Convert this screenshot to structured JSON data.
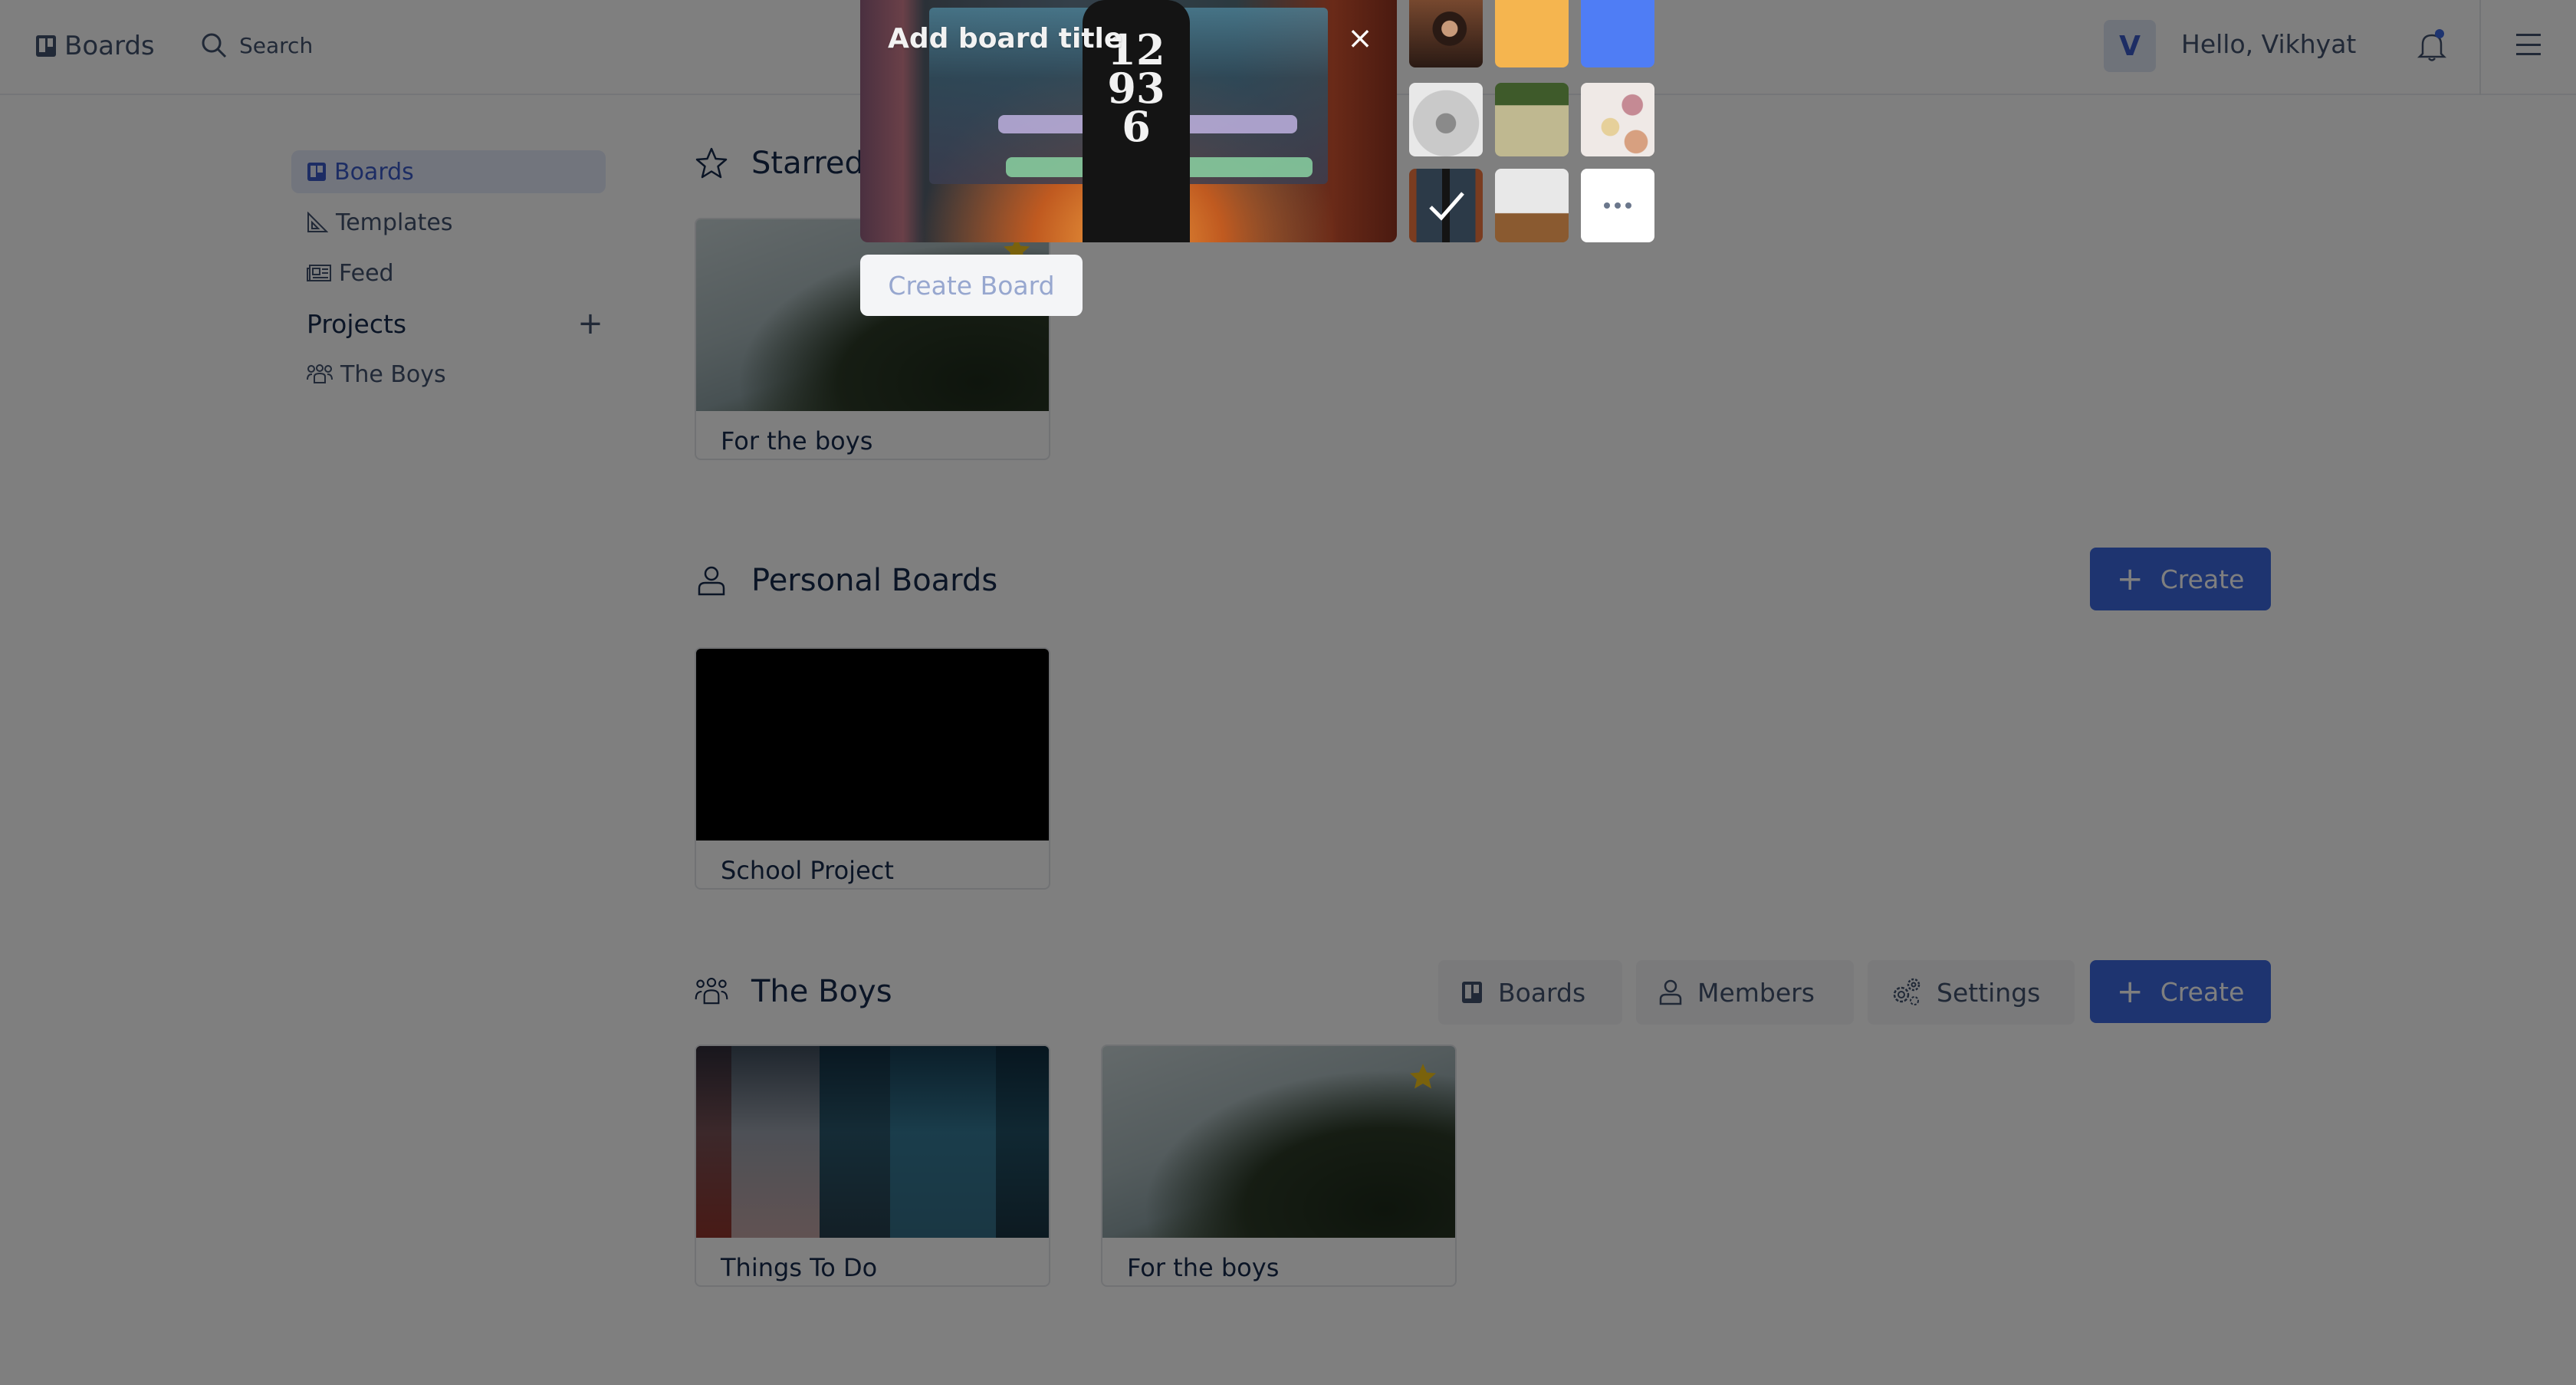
{
  "header": {
    "app_title": "Boards",
    "search_label": "Search",
    "avatar_initial": "V",
    "greeting": "Hello, Vikhyat",
    "notification_dot": true
  },
  "sidebar": {
    "items": [
      {
        "label": "Boards",
        "icon": "board-icon",
        "active": true
      },
      {
        "label": "Templates",
        "icon": "set-square-icon",
        "active": false
      },
      {
        "label": "Feed",
        "icon": "newspaper-icon",
        "active": false
      }
    ],
    "projects_label": "Projects",
    "projects": [
      {
        "label": "The Boys",
        "icon": "users-icon"
      }
    ]
  },
  "sections": {
    "starred": {
      "title": "Starred Boards",
      "visible_title": "Starred",
      "boards": [
        {
          "title": "For the boys",
          "starred": true
        }
      ]
    },
    "personal": {
      "title": "Personal Boards",
      "create_label": "Create",
      "boards": [
        {
          "title": "School Project",
          "starred": false
        }
      ]
    },
    "team": {
      "title": "The Boys",
      "buttons": {
        "boards": "Boards",
        "members": "Members",
        "settings": "Settings",
        "create": "Create"
      },
      "boards": [
        {
          "title": "Things To Do",
          "starred": false
        },
        {
          "title": "For the boys",
          "starred": true
        }
      ]
    }
  },
  "modal": {
    "title_placeholder": "Add board title",
    "close_label": "×",
    "create_button": "Create Board",
    "backgrounds": [
      {
        "type": "photo",
        "name": "man-portrait",
        "selected": false
      },
      {
        "type": "color",
        "name": "orange",
        "color": "#F5B54F",
        "selected": false
      },
      {
        "type": "color",
        "name": "blue",
        "color": "#4F7DF5",
        "selected": false
      },
      {
        "type": "photo",
        "name": "pumpkin-sketch",
        "selected": false
      },
      {
        "type": "photo",
        "name": "park-people",
        "selected": false
      },
      {
        "type": "photo",
        "name": "soap-bars",
        "selected": false
      },
      {
        "type": "photo",
        "name": "watch-desk",
        "selected": true
      },
      {
        "type": "photo",
        "name": "imac-desk",
        "selected": false
      },
      {
        "type": "more",
        "name": "more-backgrounds",
        "selected": false
      }
    ],
    "preview_watch_text": [
      "12",
      "9",
      "6",
      "3"
    ]
  },
  "colors": {
    "accent": "#3D68E0",
    "star": "#F5C518",
    "overlay": "rgba(0,0,0,0.5)"
  }
}
